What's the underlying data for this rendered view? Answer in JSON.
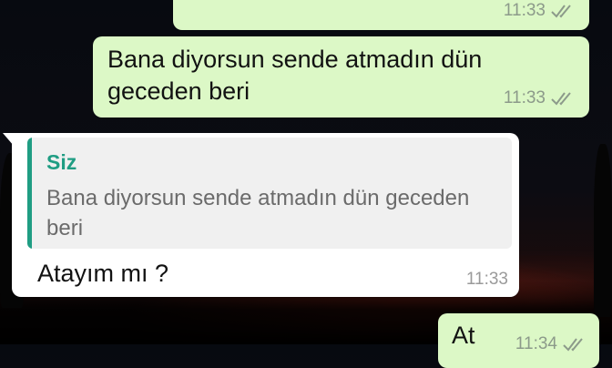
{
  "messages": [
    {
      "type": "outgoing",
      "text": "",
      "time": "11:33",
      "status": "read"
    },
    {
      "type": "outgoing",
      "text": "Bana diyorsun sende atmadın dün geceden beri",
      "time": "11:33",
      "status": "read"
    },
    {
      "type": "incoming",
      "quote": {
        "author": "Siz",
        "text": "Bana diyorsun sende atmadın dün geceden beri"
      },
      "text": "Atayım mı ?",
      "time": "11:33"
    },
    {
      "type": "outgoing",
      "text": "At",
      "time": "11:34",
      "status": "read"
    }
  ],
  "colors": {
    "outgoing_bubble": "#dcf8c6",
    "incoming_bubble": "#ffffff",
    "quote_accent": "#1f9d83",
    "tick_read": "#8c9a8a"
  },
  "icons": {
    "status": "double-check-icon"
  }
}
